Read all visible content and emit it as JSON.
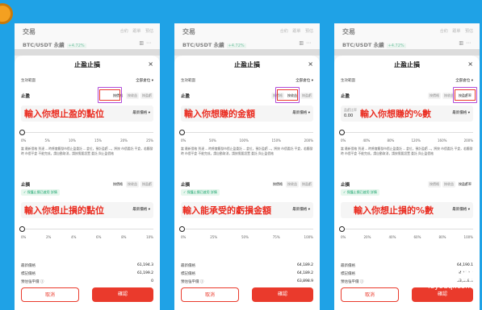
{
  "app": {
    "title": "交易",
    "tabs": [
      "合約",
      "跟單",
      "預估"
    ],
    "pair": "BTC/USDT 永續",
    "change_badge": "+4.72%",
    "header_icons": [
      "candle-icon",
      "more-icon"
    ]
  },
  "panels": [
    {
      "sheet_title": "止盈止損",
      "mode_label": "生效範圍",
      "mode_value": "全部倉位 ▾",
      "tp": {
        "label": "止盈",
        "segments": [
          "按價格",
          "按收益",
          "按盈虧"
        ],
        "input_placeholder": "",
        "input_value": "",
        "dropdown": "最新價格 ▾",
        "overlay_text": "輸入你想止盈的點位",
        "ticks": [
          "0%",
          "5%",
          "10%",
          "15%",
          "20%",
          "25%"
        ],
        "note": "當 最新價格 到達 -- 時將會觸發市價止盈委託 -- 倉位，預計盈虧 --。將按 市價委託 平倉，若觸發時 市價平倉 不能完成，請自動取消，請按需要設置 委託 與止盈價格"
      },
      "sl": {
        "label": "止損",
        "segments": [
          "按價格",
          "按收益",
          "按盈虧"
        ],
        "protect": "保護止損已啟用",
        "protect_tag": "詳情",
        "dropdown": "最新價格 ▾",
        "overlay_text": "輸入你想止損的點位",
        "ticks": [
          "0%",
          "2%",
          "4%",
          "6%",
          "8%",
          "10%"
        ]
      },
      "info": [
        {
          "k": "最新價格",
          "v": "61,194.3"
        },
        {
          "k": "標記價格",
          "v": "61,199.2"
        },
        {
          "k": "預估強平價 ⓘ",
          "v": "0"
        }
      ],
      "cancel": "取消",
      "confirm": "確認"
    },
    {
      "sheet_title": "止盈止損",
      "mode_label": "生效範圍",
      "mode_value": "全部倉位 ▾",
      "tp": {
        "label": "止盈",
        "segments": [
          "按價格",
          "按收益",
          "按盈虧"
        ],
        "input_placeholder": "收益",
        "input_value": "",
        "dropdown": "最新價格 ▾",
        "overlay_text": "輸入你想賺的金額",
        "ticks": [
          "0%",
          "50%",
          "100%",
          "150%",
          "200%"
        ],
        "note": "當 最新價格 到達 -- 時將會觸發市價止盈委託 -- 倉位，預計盈虧 --。將按 市價委託 平倉，若觸發時 市價平倉 不能完成，請自動取消，請按需要設置 委託 與止盈價格"
      },
      "sl": {
        "label": "止損",
        "segments": [
          "按價格",
          "按收益",
          "按盈虧"
        ],
        "protect": "保護止損已啟用",
        "protect_tag": "詳情",
        "dropdown": "最新價格 ▾",
        "overlay_text": "輸入能承受的虧損金額",
        "ticks": [
          "0%",
          "25%",
          "50%",
          "75%",
          "100%"
        ]
      },
      "info": [
        {
          "k": "最新價格",
          "v": "64,189.2"
        },
        {
          "k": "標記價格",
          "v": "64,189.2"
        },
        {
          "k": "預估強平價 ⓘ",
          "v": "63,898.9"
        }
      ],
      "cancel": "取消",
      "confirm": "確認"
    },
    {
      "sheet_title": "止盈止損",
      "mode_label": "生效範圍",
      "mode_value": "全部倉位 ▾",
      "tp": {
        "label": "止盈",
        "segments": [
          "按價格",
          "按收益",
          "按盈虧率"
        ],
        "input_placeholder": "盈虧比率",
        "input_value": "0.00",
        "dropdown": "最新價格 ▾",
        "overlay_text": "輸入你想賺的%數",
        "ticks": [
          "0%",
          "40%",
          "80%",
          "120%",
          "160%",
          "200%"
        ],
        "note": "當 最新價格 到達 -- 時將會觸發市價止盈委託 -- 倉位，預計盈虧 --。將按 市價委託 平倉，若觸發時 市價平倉 不能完成，請自動取消，請按需要設置 委託 與止盈價格"
      },
      "sl": {
        "label": "止損",
        "segments": [
          "按價格",
          "按收益",
          "按盈虧率"
        ],
        "protect": "保護止損已啟用",
        "protect_tag": "詳情",
        "dropdown": "最新價格 ▾",
        "overlay_text": "輸入你想止損的%數",
        "ticks": [
          "0%",
          "20%",
          "40%",
          "60%",
          "80%",
          "100%"
        ]
      },
      "info": [
        {
          "k": "最新價格",
          "v": "64,190.1"
        },
        {
          "k": "標記價格",
          "v": "64,139.2"
        },
        {
          "k": "預估強平價 ⓘ",
          "v": "63,898.9"
        }
      ],
      "cancel": "取消",
      "confirm": "確認"
    }
  ],
  "watermark": {
    "cn": "路由器",
    "en": "luyouqi.com"
  },
  "colors": {
    "background": "#1fa2e6",
    "accent": "#ea3a2c",
    "highlight": "#b14bd8",
    "positive": "#17a36b"
  }
}
